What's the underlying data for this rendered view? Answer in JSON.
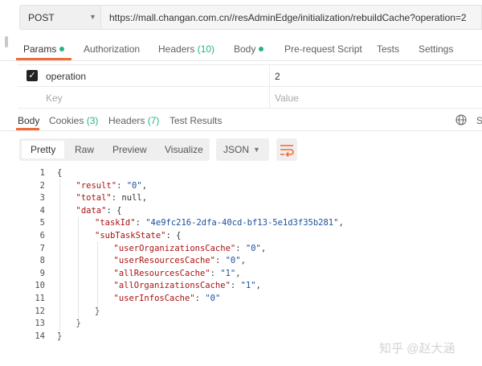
{
  "request": {
    "method": "POST",
    "url": "https://mall.changan.com.cn//resAdminEdge/initialization/rebuildCache?operation=2"
  },
  "request_tabs": [
    {
      "label": "Params",
      "active": true,
      "dot": true
    },
    {
      "label": "Authorization"
    },
    {
      "label": "Headers",
      "count": "(10)"
    },
    {
      "label": "Body",
      "dot": true
    },
    {
      "label": "Pre-request Script"
    },
    {
      "label": "Tests"
    },
    {
      "label": "Settings"
    }
  ],
  "params": {
    "rows": [
      {
        "checked": true,
        "key": "operation",
        "value": "2"
      }
    ],
    "key_placeholder": "Key",
    "value_placeholder": "Value"
  },
  "response_tabs": [
    {
      "label": "Body",
      "active": true
    },
    {
      "label": "Cookies",
      "count": "(3)"
    },
    {
      "label": "Headers",
      "count": "(7)"
    },
    {
      "label": "Test Results"
    }
  ],
  "response_right_cut": "S",
  "formats": [
    "Pretty",
    "Raw",
    "Preview",
    "Visualize"
  ],
  "format_selected": "Pretty",
  "language": "JSON",
  "code_lines": [
    {
      "n": "1",
      "indent": 0,
      "parts": [
        [
          "p",
          "{"
        ]
      ]
    },
    {
      "n": "2",
      "indent": 1,
      "parts": [
        [
          "k",
          "\"result\""
        ],
        [
          "p",
          ": "
        ],
        [
          "s",
          "\"0\""
        ],
        [
          "p",
          ","
        ]
      ]
    },
    {
      "n": "3",
      "indent": 1,
      "parts": [
        [
          "k",
          "\"total\""
        ],
        [
          "p",
          ": "
        ],
        [
          "p",
          "null"
        ],
        [
          "p",
          ","
        ]
      ]
    },
    {
      "n": "4",
      "indent": 1,
      "parts": [
        [
          "k",
          "\"data\""
        ],
        [
          "p",
          ": {"
        ]
      ]
    },
    {
      "n": "5",
      "indent": 2,
      "parts": [
        [
          "k",
          "\"taskId\""
        ],
        [
          "p",
          ": "
        ],
        [
          "s",
          "\"4e9fc216-2dfa-40cd-bf13-5e1d3f35b281\""
        ],
        [
          "p",
          ","
        ]
      ]
    },
    {
      "n": "6",
      "indent": 2,
      "parts": [
        [
          "k",
          "\"subTaskState\""
        ],
        [
          "p",
          ": {"
        ]
      ]
    },
    {
      "n": "7",
      "indent": 3,
      "parts": [
        [
          "k",
          "\"userOrganizationsCache\""
        ],
        [
          "p",
          ": "
        ],
        [
          "s",
          "\"0\""
        ],
        [
          "p",
          ","
        ]
      ]
    },
    {
      "n": "8",
      "indent": 3,
      "parts": [
        [
          "k",
          "\"userResourcesCache\""
        ],
        [
          "p",
          ": "
        ],
        [
          "s",
          "\"0\""
        ],
        [
          "p",
          ","
        ]
      ]
    },
    {
      "n": "9",
      "indent": 3,
      "parts": [
        [
          "k",
          "\"allResourcesCache\""
        ],
        [
          "p",
          ": "
        ],
        [
          "s",
          "\"1\""
        ],
        [
          "p",
          ","
        ]
      ]
    },
    {
      "n": "10",
      "indent": 3,
      "parts": [
        [
          "k",
          "\"allOrganizationsCache\""
        ],
        [
          "p",
          ": "
        ],
        [
          "s",
          "\"1\""
        ],
        [
          "p",
          ","
        ]
      ]
    },
    {
      "n": "11",
      "indent": 3,
      "parts": [
        [
          "k",
          "\"userInfosCache\""
        ],
        [
          "p",
          ": "
        ],
        [
          "s",
          "\"0\""
        ]
      ]
    },
    {
      "n": "12",
      "indent": 2,
      "parts": [
        [
          "p",
          "}"
        ]
      ]
    },
    {
      "n": "13",
      "indent": 1,
      "parts": [
        [
          "p",
          "}"
        ]
      ]
    },
    {
      "n": "14",
      "indent": 0,
      "parts": [
        [
          "p",
          "}"
        ]
      ]
    }
  ],
  "watermark": "知乎 @赵大涵",
  "colors": {
    "accent": "#f26b3a",
    "green": "#26b47f",
    "json_key": "#a11111",
    "json_string": "#1a4f9c"
  }
}
